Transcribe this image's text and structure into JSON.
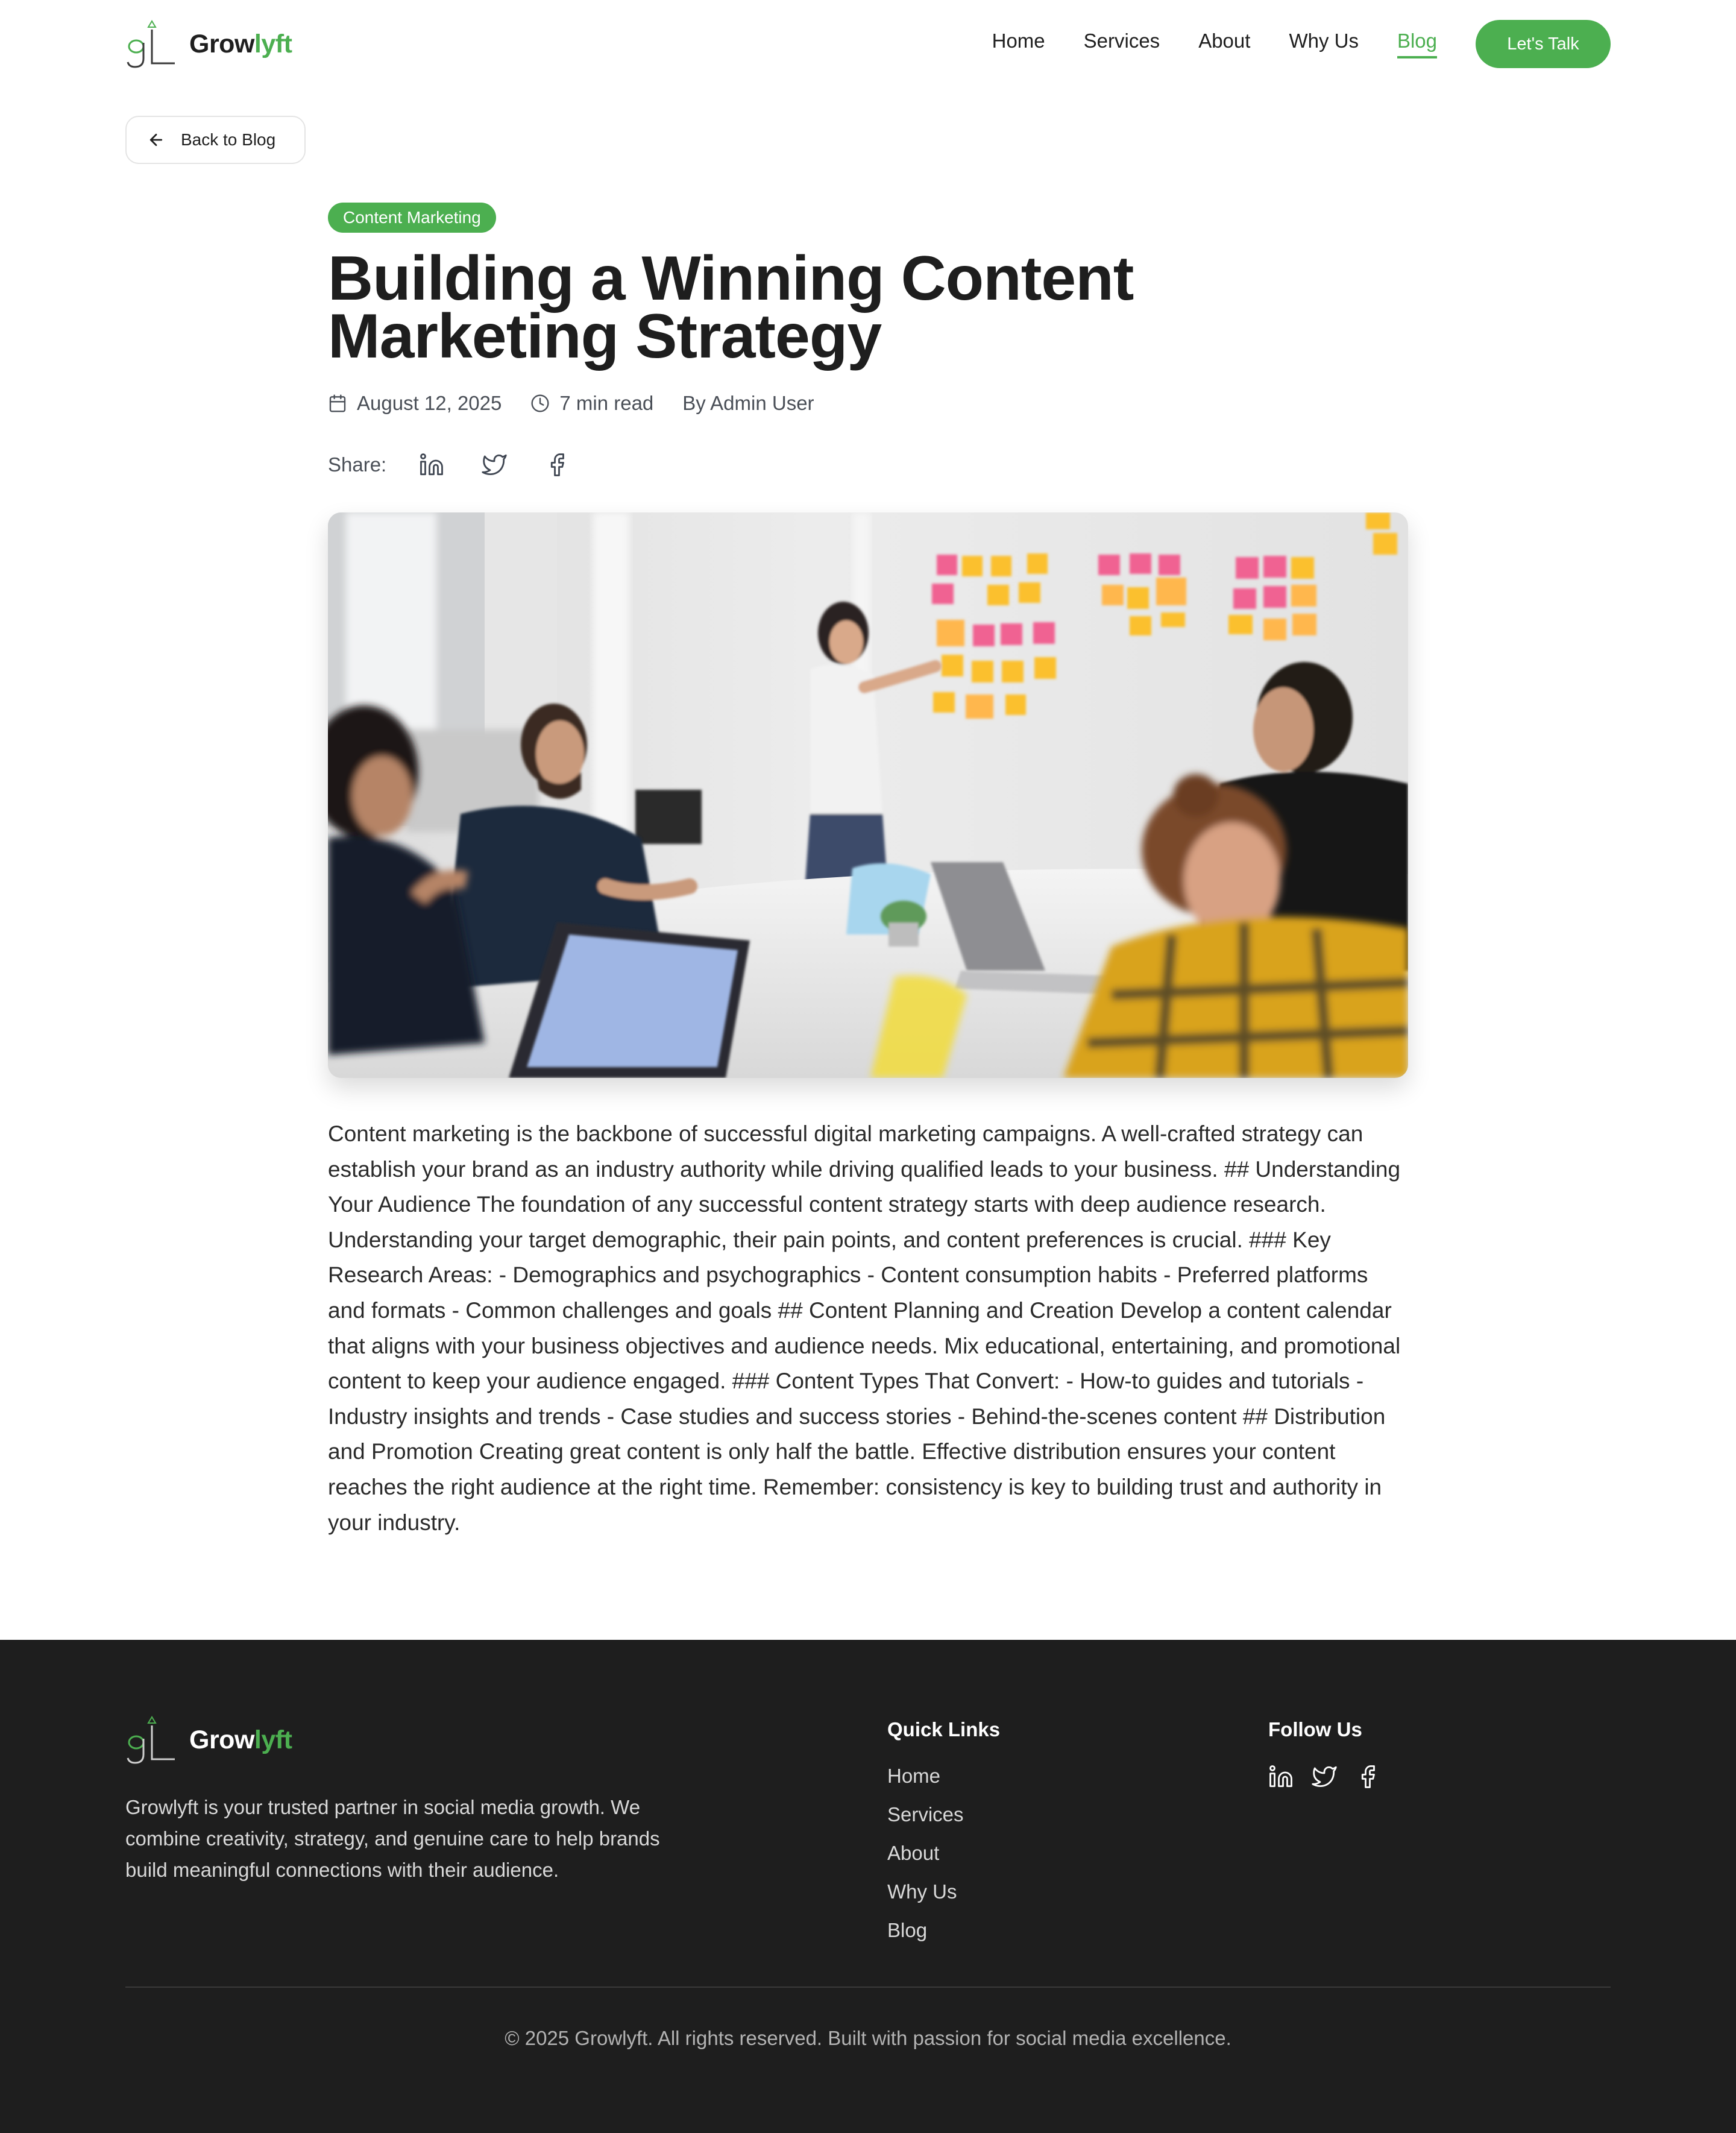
{
  "brand": {
    "name_part1": "Grow",
    "name_part2": "lyft",
    "accent_color": "#4caf50"
  },
  "nav": {
    "items": [
      {
        "label": "Home"
      },
      {
        "label": "Services"
      },
      {
        "label": "About"
      },
      {
        "label": "Why Us"
      },
      {
        "label": "Blog",
        "active": true
      }
    ],
    "cta_label": "Let's Talk"
  },
  "back_button": {
    "label": "Back to Blog",
    "icon": "arrow-left-icon"
  },
  "article": {
    "category": "Content Marketing",
    "title": "Building a Winning Content Marketing Strategy",
    "date": "August 12, 2025",
    "read_time": "7 min read",
    "author": "By Admin User",
    "share_label": "Share:",
    "share_icons": [
      "linkedin-icon",
      "twitter-icon",
      "facebook-icon"
    ],
    "hero_image": "team-meeting-sticky-notes-photo",
    "body": "Content marketing is the backbone of successful digital marketing campaigns. A well-crafted strategy can establish your brand as an industry authority while driving qualified leads to your business. ## Understanding Your Audience The foundation of any successful content strategy starts with deep audience research. Understanding your target demographic, their pain points, and content preferences is crucial. ### Key Research Areas: - Demographics and psychographics - Content consumption habits - Preferred platforms and formats - Common challenges and goals ## Content Planning and Creation Develop a content calendar that aligns with your business objectives and audience needs. Mix educational, entertaining, and promotional content to keep your audience engaged. ### Content Types That Convert: - How-to guides and tutorials - Industry insights and trends - Case studies and success stories - Behind-the-scenes content ## Distribution and Promotion Creating great content is only half the battle. Effective distribution ensures your content reaches the right audience at the right time. Remember: consistency is key to building trust and authority in your industry."
  },
  "footer": {
    "description": "Growlyft is your trusted partner in social media growth. We combine creativity, strategy, and genuine care to help brands build meaningful connections with their audience.",
    "quick_links_title": "Quick Links",
    "quick_links": [
      "Home",
      "Services",
      "About",
      "Why Us",
      "Blog"
    ],
    "follow_title": "Follow Us",
    "follow_icons": [
      "linkedin-icon",
      "twitter-icon",
      "facebook-icon"
    ],
    "copyright": "© 2025 Growlyft. All rights reserved. Built with passion for social media excellence.",
    "background": "#1e1e1e"
  }
}
